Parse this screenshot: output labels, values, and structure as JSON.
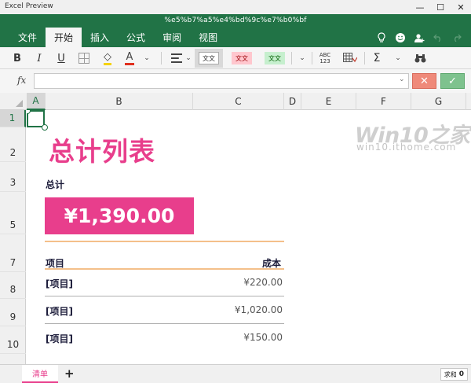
{
  "window": {
    "app_title": "Excel Preview",
    "minimize": "—",
    "maximize": "☐",
    "close": "✕"
  },
  "ribbon": {
    "doc_title": "%e5%b7%a5%e4%bd%9c%e7%b0%bf",
    "tabs": [
      {
        "label": "文件"
      },
      {
        "label": "开始"
      },
      {
        "label": "插入"
      },
      {
        "label": "公式"
      },
      {
        "label": "审阅"
      },
      {
        "label": "视图"
      }
    ],
    "active_tab": "开始",
    "accent_color": "#217346"
  },
  "toolbar": {
    "bold": "B",
    "italic": "I",
    "underline": "U",
    "fill_color_glyph": "◇",
    "font_color_glyph": "A",
    "style_normal": "文文",
    "style_bad": "文文",
    "style_good": "文文",
    "number_format_top": "ABC",
    "number_format_bottom": "123",
    "sum_glyph": "Σ",
    "chevron": "⌄"
  },
  "formula_bar": {
    "fx_label": "fx",
    "value": "",
    "cancel_glyph": "✕",
    "confirm_glyph": "✓"
  },
  "grid": {
    "columns": [
      "A",
      "B",
      "C",
      "D",
      "E",
      "F",
      "G"
    ],
    "selected_column": "A",
    "rows": [
      "1",
      "2",
      "3",
      "5",
      "7",
      "8",
      "9",
      "10"
    ],
    "selected_row": "1"
  },
  "sheet": {
    "title": "总计列表",
    "total_label": "总计",
    "total_value": "¥1,390.00",
    "table_header_item": "项目",
    "table_header_cost": "成本",
    "items": [
      {
        "name": "[项目]",
        "cost": "¥220.00"
      },
      {
        "name": "[项目]",
        "cost": "¥1,020.00"
      },
      {
        "name": "[项目]",
        "cost": "¥150.00"
      }
    ],
    "accent_color": "#e83e8c"
  },
  "watermark": {
    "main": "Win10之家",
    "sub": "win10.ithome.com"
  },
  "statusbar": {
    "sheet_tab": "清单",
    "add_sheet": "+",
    "sum_label": "求和",
    "sum_value": "0"
  }
}
